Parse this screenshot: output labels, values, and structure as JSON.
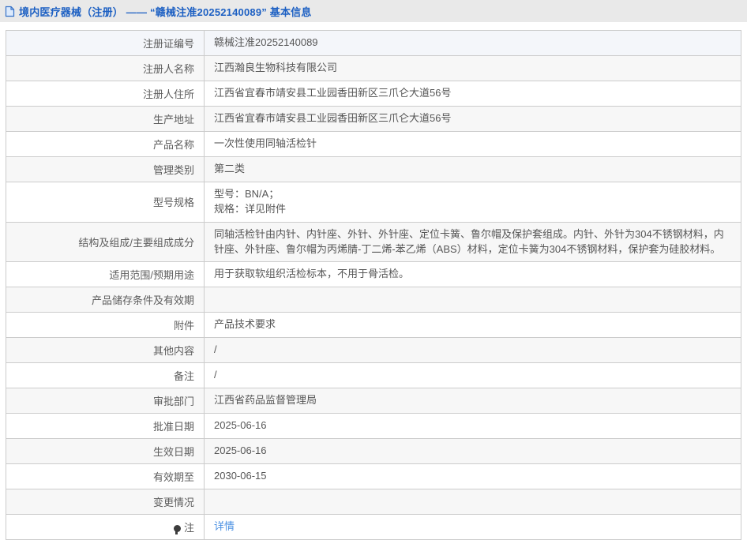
{
  "header": {
    "icon": "document-icon",
    "title": "境内医疗器械（注册） —— “赣械注准20252140089” 基本信息"
  },
  "table": {
    "rows": [
      {
        "label": "注册证编号",
        "value": "赣械注准20252140089",
        "highlight": true
      },
      {
        "label": "注册人名称",
        "value": "江西瀚良生物科技有限公司"
      },
      {
        "label": "注册人住所",
        "value": "江西省宜春市靖安县工业园香田新区三爪仑大道56号"
      },
      {
        "label": "生产地址",
        "value": "江西省宜春市靖安县工业园香田新区三爪仑大道56号"
      },
      {
        "label": "产品名称",
        "value": "一次性使用同轴活检针"
      },
      {
        "label": "管理类别",
        "value": "第二类"
      },
      {
        "label": "型号规格",
        "value": "型号：BN/A；\n规格：详见附件"
      },
      {
        "label": "结构及组成/主要组成成分",
        "value": "同轴活检针由内针、内针座、外针、外针座、定位卡簧、鲁尔帽及保护套组成。内针、外针为304不锈钢材料，内针座、外针座、鲁尔帽为丙烯腈-丁二烯-苯乙烯（ABS）材料，定位卡簧为304不锈钢材料，保护套为硅胶材料。"
      },
      {
        "label": "适用范围/预期用途",
        "value": "用于获取软组织活检标本，不用于骨活检。"
      },
      {
        "label": "产品储存条件及有效期",
        "value": ""
      },
      {
        "label": "附件",
        "value": "产品技术要求"
      },
      {
        "label": "其他内容",
        "value": "/"
      },
      {
        "label": "备注",
        "value": "/"
      },
      {
        "label": "审批部门",
        "value": "江西省药品监督管理局"
      },
      {
        "label": "批准日期",
        "value": "2025-06-16"
      },
      {
        "label": "生效日期",
        "value": "2025-06-16"
      },
      {
        "label": "有效期至",
        "value": "2030-06-15"
      },
      {
        "label": "变更情况",
        "value": ""
      },
      {
        "label": "注",
        "value": "详情",
        "link": true,
        "icon": "note-bulb-icon"
      }
    ]
  },
  "colors": {
    "title_blue": "#1d60c3",
    "link_blue": "#4a90e2",
    "header_bar_gray": "#e9e9e9",
    "row_alt_gray": "#f7f7f7",
    "highlight_row": "#f4f6fa",
    "border_gray": "#cccccc"
  }
}
